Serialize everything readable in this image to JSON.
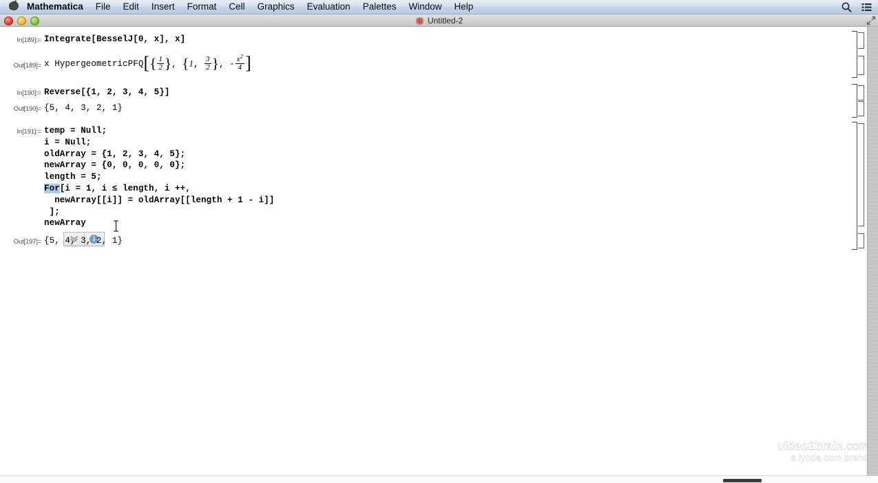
{
  "menubar": {
    "apple_icon": "apple-logo-icon",
    "items": [
      {
        "label": "Mathematica",
        "bold": true
      },
      {
        "label": "File",
        "bold": false
      },
      {
        "label": "Edit",
        "bold": false
      },
      {
        "label": "Insert",
        "bold": false
      },
      {
        "label": "Format",
        "bold": false
      },
      {
        "label": "Cell",
        "bold": false
      },
      {
        "label": "Graphics",
        "bold": false
      },
      {
        "label": "Evaluation",
        "bold": false
      },
      {
        "label": "Palettes",
        "bold": false
      },
      {
        "label": "Window",
        "bold": false
      },
      {
        "label": "Help",
        "bold": false
      }
    ],
    "right_icons": [
      {
        "name": "spotlight-search-icon"
      },
      {
        "name": "notification-center-icon"
      }
    ]
  },
  "window": {
    "title": "Untitled-2",
    "doc_icon": "mathematica-spikey-icon",
    "close_label": "Close",
    "minimize_label": "Minimize",
    "zoom_label": "Zoom",
    "resize_label": "Full Screen"
  },
  "notebook": {
    "cells": [
      {
        "id": "cell-in-189",
        "kind": "input",
        "label": "In[189]:=",
        "text": "Integrate[BesselJ[0, x], x]"
      },
      {
        "id": "cell-out-189",
        "kind": "output",
        "label": "Out[189]=",
        "text": "x HypergeometricPFQ[{1/2}, {1, 3/2}, -x^2/4]",
        "math": {
          "head": "x HypergeometricPFQ",
          "arg1_num": "1",
          "arg1_den": "2",
          "arg2_first": "1",
          "arg2_num": "3",
          "arg2_den": "2",
          "arg3_sign": "-",
          "arg3_num_base": "x",
          "arg3_num_exp": "2",
          "arg3_den": "4"
        }
      },
      {
        "id": "cell-in-190",
        "kind": "input",
        "label": "In[190]:=",
        "text": "Reverse[{1, 2, 3, 4, 5}]"
      },
      {
        "id": "cell-out-190",
        "kind": "output",
        "label": "Out[190]=",
        "text": "{5, 4, 3, 2, 1}"
      },
      {
        "id": "cell-in-191",
        "kind": "input",
        "label": "In[191]:=",
        "lines": [
          "temp = Null;",
          "i = Null;",
          "oldArray = {1, 2, 3, 4, 5};",
          "newArray = {0, 0, 0, 0, 0};",
          "length = 5;"
        ],
        "for_keyword": "For",
        "for_rest": "[i = 1, i ≤ length, i ++,",
        "for_body": "newArray[[i]] = oldArray[[length + 1 - i]]",
        "for_close": "];",
        "tail": "newArray"
      },
      {
        "id": "cell-out-197",
        "kind": "output",
        "label": "Out[197]=",
        "text": "{5, 4, 3, 2, 1}"
      }
    ],
    "popup": {
      "name": "code-assist-popup",
      "expand_icon": "double-chevron-down-icon",
      "info_icon": "info-circle-icon"
    },
    "scrollbar_vertical": "vertical-scrollbar",
    "scrollbar_horizontal": "horizontal-scrollbar"
  },
  "watermark": {
    "line1_strong": "video2brain",
    "line1_dim": ".com",
    "line2": "a lynda.com brand"
  },
  "colors": {
    "selection_highlight": "#aeccec",
    "menubar_top": "#e8eef7",
    "menubar_bottom": "#b9cbe6",
    "io_label": "#4a4f60",
    "bracket": "#5d5d77",
    "info_blue": "#5b8ec4"
  }
}
